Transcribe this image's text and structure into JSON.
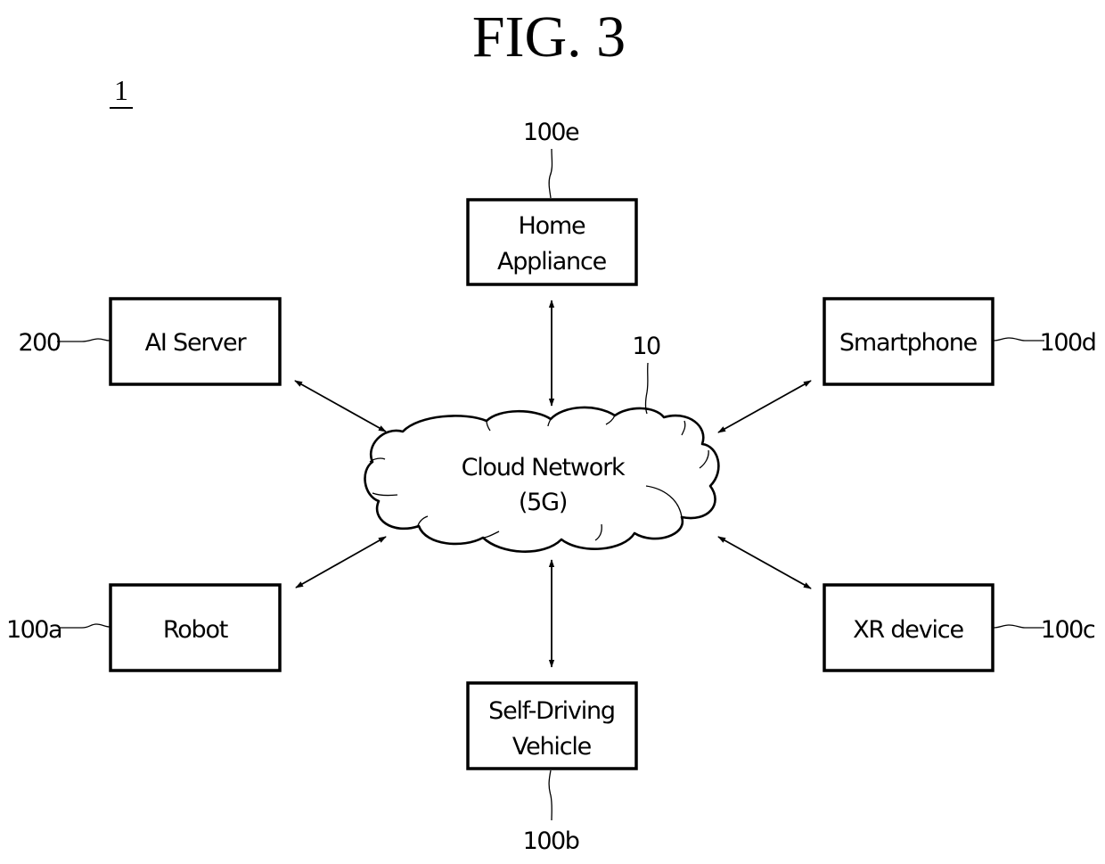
{
  "figure": {
    "title": "FIG. 3",
    "system_label": "1"
  },
  "network": {
    "label_line1": "Cloud Network",
    "label_line2": "(5G)",
    "ref": "10"
  },
  "nodes": {
    "home_appliance": {
      "line1": "Home",
      "line2": "Appliance",
      "ref": "100e"
    },
    "ai_server": {
      "line1": "AI Server",
      "ref": "200"
    },
    "smartphone": {
      "line1": "Smartphone",
      "ref": "100d"
    },
    "robot": {
      "line1": "Robot",
      "ref": "100a"
    },
    "xr_device": {
      "line1": "XR device",
      "ref": "100c"
    },
    "self_driving_vehicle": {
      "line1": "Self-Driving",
      "line2": "Vehicle",
      "ref": "100b"
    }
  },
  "connections": [
    {
      "from": "home_appliance",
      "to": "network",
      "type": "bidirectional"
    },
    {
      "from": "ai_server",
      "to": "network",
      "type": "bidirectional"
    },
    {
      "from": "smartphone",
      "to": "network",
      "type": "bidirectional"
    },
    {
      "from": "robot",
      "to": "network",
      "type": "bidirectional"
    },
    {
      "from": "xr_device",
      "to": "network",
      "type": "bidirectional"
    },
    {
      "from": "self_driving_vehicle",
      "to": "network",
      "type": "bidirectional"
    }
  ]
}
